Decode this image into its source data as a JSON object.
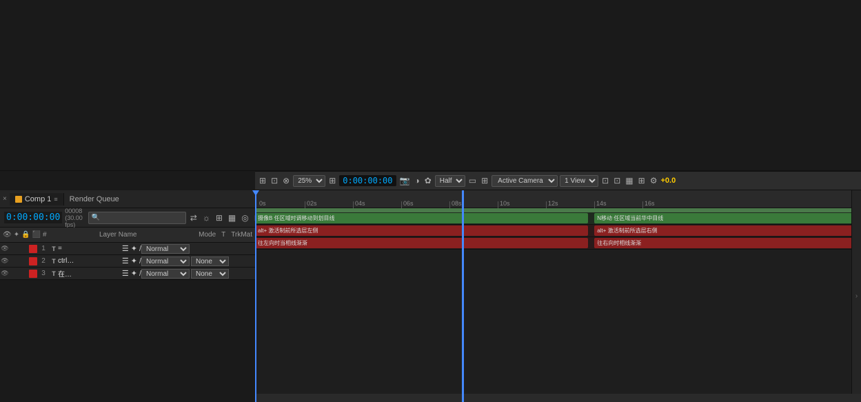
{
  "preview": {
    "background": "#1a1a1a"
  },
  "viewer_toolbar": {
    "zoom": "25%",
    "timecode": "0:00:00:00",
    "quality": "Half",
    "camera": "Active Camera",
    "view": "1 View",
    "offset": "+0.0"
  },
  "comp_tab": {
    "close": "×",
    "name": "Comp 1",
    "menu": "≡",
    "render_queue": "Render Queue"
  },
  "timeline": {
    "timecode": "0:00:00:00",
    "fps": "00008 (30.00 fps)",
    "search_placeholder": "🔍",
    "ruler_marks": [
      "0s",
      "02s",
      "04s",
      "06s",
      "08s",
      "10s",
      "12s",
      "14s",
      "16s"
    ]
  },
  "layer_header": {
    "col_icons": "⊙ ✦ ⊗ ⊕",
    "col_name": "Layer Name",
    "col_mode": "Mode",
    "col_t": "T",
    "col_trkmat": "TrkMat"
  },
  "layers": [
    {
      "num": "1",
      "type": "T",
      "name": "=",
      "mode": "Normal",
      "trkmat": ""
    },
    {
      "num": "2",
      "type": "T",
      "name": "ctrl+shift+D",
      "mode": "Normal",
      "trkmat": "None"
    },
    {
      "num": "3",
      "type": "T",
      "name": "在当前时间线切割层",
      "mode": "Normal",
      "trkmat": "None"
    }
  ],
  "track_bars": {
    "row1": {
      "bars": [
        {
          "label": "摄像B   任区域时调移动到划目线",
          "start_pct": 0,
          "width_pct": 55,
          "type": "green"
        },
        {
          "label": "N移动  任区域当前华中目线",
          "start_pct": 55,
          "width_pct": 45,
          "type": "green"
        }
      ]
    },
    "row2": {
      "bars": [
        {
          "label": "alt+ 激活制前所选层左侧",
          "start_pct": 0,
          "width_pct": 55,
          "type": "red"
        },
        {
          "label": "alt+ 激活制前所选层右侧",
          "start_pct": 55,
          "width_pct": 45,
          "type": "red"
        }
      ]
    },
    "row3": {
      "bars": [
        {
          "label": "往左向时当相线渐渐",
          "start_pct": 0,
          "width_pct": 55,
          "type": "red"
        },
        {
          "label": "往右向时相线渐渐",
          "start_pct": 55,
          "width_pct": 45,
          "type": "red"
        }
      ]
    }
  }
}
